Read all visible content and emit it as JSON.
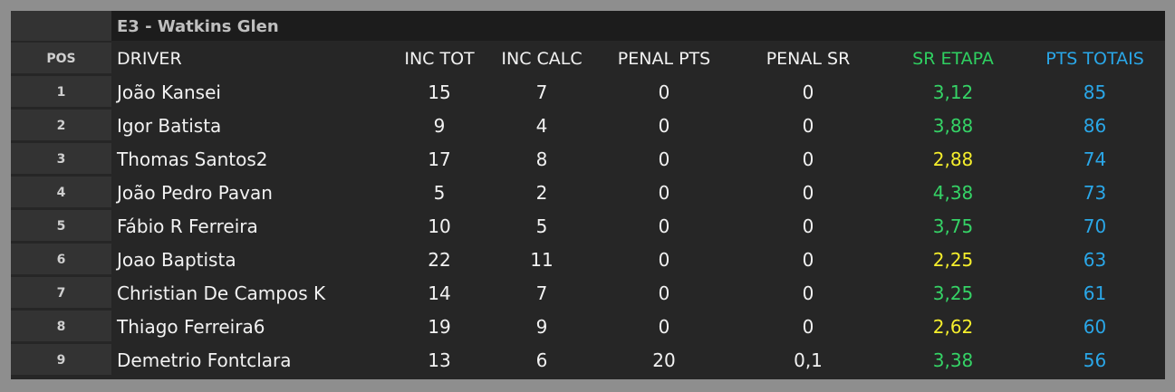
{
  "title": "E3 - Watkins Glen",
  "headers": {
    "pos": "POS",
    "driver": "DRIVER",
    "inc_tot": "INC TOT",
    "inc_calc": "INC CALC",
    "penal_pts": "PENAL PTS",
    "penal_sr": "PENAL SR",
    "sr_etapa": "SR ETAPA",
    "pts_totais": "PTS TOTAIS"
  },
  "colors": {
    "sr_green": "#35d366",
    "sr_yellow": "#f5ee2c",
    "pts_blue": "#2aa7e8"
  },
  "rows": [
    {
      "pos": "1",
      "driver": "João Kansei",
      "inc_tot": "15",
      "inc_calc": "7",
      "penal_pts": "0",
      "penal_sr": "0",
      "sr_etapa": "3,12",
      "sr_color": "green",
      "pts_totais": "85"
    },
    {
      "pos": "2",
      "driver": "Igor Batista",
      "inc_tot": "9",
      "inc_calc": "4",
      "penal_pts": "0",
      "penal_sr": "0",
      "sr_etapa": "3,88",
      "sr_color": "green",
      "pts_totais": "86"
    },
    {
      "pos": "3",
      "driver": "Thomas Santos2",
      "inc_tot": "17",
      "inc_calc": "8",
      "penal_pts": "0",
      "penal_sr": "0",
      "sr_etapa": "2,88",
      "sr_color": "yellow",
      "pts_totais": "74"
    },
    {
      "pos": "4",
      "driver": "João Pedro Pavan",
      "inc_tot": "5",
      "inc_calc": "2",
      "penal_pts": "0",
      "penal_sr": "0",
      "sr_etapa": "4,38",
      "sr_color": "green",
      "pts_totais": "73"
    },
    {
      "pos": "5",
      "driver": "Fábio R Ferreira",
      "inc_tot": "10",
      "inc_calc": "5",
      "penal_pts": "0",
      "penal_sr": "0",
      "sr_etapa": "3,75",
      "sr_color": "green",
      "pts_totais": "70"
    },
    {
      "pos": "6",
      "driver": "Joao Baptista",
      "inc_tot": "22",
      "inc_calc": "11",
      "penal_pts": "0",
      "penal_sr": "0",
      "sr_etapa": "2,25",
      "sr_color": "yellow",
      "pts_totais": "63"
    },
    {
      "pos": "7",
      "driver": "Christian De Campos K",
      "inc_tot": "14",
      "inc_calc": "7",
      "penal_pts": "0",
      "penal_sr": "0",
      "sr_etapa": "3,25",
      "sr_color": "green",
      "pts_totais": "61"
    },
    {
      "pos": "8",
      "driver": "Thiago Ferreira6",
      "inc_tot": "19",
      "inc_calc": "9",
      "penal_pts": "0",
      "penal_sr": "0",
      "sr_etapa": "2,62",
      "sr_color": "yellow",
      "pts_totais": "60"
    },
    {
      "pos": "9",
      "driver": "Demetrio Fontclara",
      "inc_tot": "13",
      "inc_calc": "6",
      "penal_pts": "20",
      "penal_sr": "0,1",
      "sr_etapa": "3,38",
      "sr_color": "green",
      "pts_totais": "56"
    }
  ]
}
